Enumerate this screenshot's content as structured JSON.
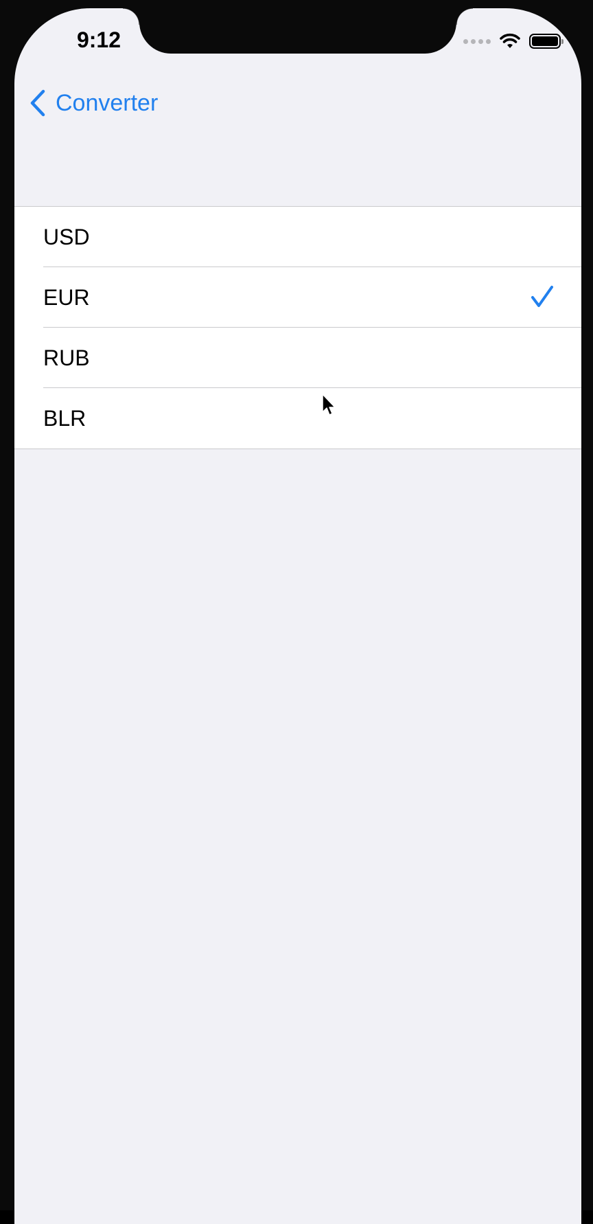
{
  "status_bar": {
    "time": "9:12"
  },
  "nav": {
    "back_label": "Converter"
  },
  "currencies": [
    {
      "label": "USD",
      "selected": false
    },
    {
      "label": "EUR",
      "selected": true
    },
    {
      "label": "RUB",
      "selected": false
    },
    {
      "label": "BLR",
      "selected": false
    }
  ],
  "colors": {
    "accent": "#2180ee",
    "background": "#f1f1f6",
    "separator": "#c9c9cc"
  },
  "icons": {
    "back": "chevron-left-icon",
    "selected": "checkmark-icon",
    "wifi": "wifi-icon",
    "battery": "battery-icon"
  }
}
